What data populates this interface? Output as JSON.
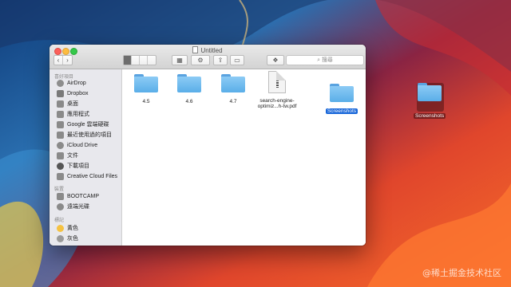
{
  "window": {
    "title": "Untitled"
  },
  "toolbar": {
    "back_icon": "chevron-left-icon",
    "forward_icon": "chevron-right-icon",
    "search_placeholder": "搜尋"
  },
  "sidebar": {
    "sections": [
      {
        "heading": "喜好項目",
        "items": [
          {
            "label": "AirDrop",
            "icon": "airdrop-icon"
          },
          {
            "label": "Dropbox",
            "icon": "dropbox-icon"
          },
          {
            "label": "桌面",
            "icon": "desktop-icon"
          },
          {
            "label": "應用程式",
            "icon": "applications-icon"
          },
          {
            "label": "Google 雲端硬碟",
            "icon": "google-drive-icon"
          },
          {
            "label": "最近使用過的項目",
            "icon": "recents-icon"
          },
          {
            "label": "iCloud Drive",
            "icon": "cloud-icon"
          },
          {
            "label": "文件",
            "icon": "documents-icon"
          },
          {
            "label": "下載項目",
            "icon": "downloads-icon"
          },
          {
            "label": "Creative Cloud Files",
            "icon": "creative-cloud-icon"
          }
        ]
      },
      {
        "heading": "裝置",
        "items": [
          {
            "label": "BOOTCAMP",
            "icon": "disk-icon"
          },
          {
            "label": "遠端光碟",
            "icon": "optical-disc-icon"
          }
        ]
      },
      {
        "heading": "標記",
        "items": [
          {
            "label": "黃色",
            "icon": "tag-yellow-icon",
            "color": "#f5c242"
          },
          {
            "label": "灰色",
            "icon": "tag-gray-icon",
            "color": "#9a9a9a"
          }
        ]
      }
    ]
  },
  "files": [
    {
      "name": "4.5",
      "type": "folder"
    },
    {
      "name": "4.6",
      "type": "folder"
    },
    {
      "name": "4.7",
      "type": "folder"
    },
    {
      "name_line1": "search-engine-",
      "name_line2": "optimiz...h-tw.pdf",
      "type": "pdf"
    },
    {
      "name": "Screenshots",
      "type": "folder",
      "selected": true
    }
  ],
  "dragged": {
    "name": "Screenshots"
  },
  "watermark": "@稀土掘金技术社区",
  "colors": {
    "selection": "#1766d9",
    "folder": "#5aaee8"
  }
}
